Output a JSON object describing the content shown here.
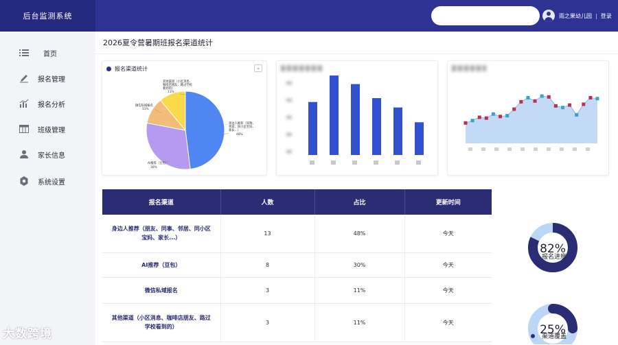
{
  "app": {
    "title": "后台监测系统"
  },
  "header": {
    "search_placeholder": "",
    "user_name": "雨之果幼儿园",
    "separator": "|",
    "login_label": "登录"
  },
  "sidebar": {
    "items": [
      {
        "label": "首页",
        "icon": "list-icon"
      },
      {
        "label": "报名管理",
        "icon": "pencil-icon"
      },
      {
        "label": "报名分析",
        "icon": "bar-chart-icon"
      },
      {
        "label": "班级管理",
        "icon": "grid-icon"
      },
      {
        "label": "家长信息",
        "icon": "person-icon"
      },
      {
        "label": "系统设置",
        "icon": "gear-icon"
      }
    ]
  },
  "main": {
    "page_title": "2026夏令营暑期班报名渠道统计",
    "pie_card": {
      "title": "报名渠道统计",
      "labels": [
        {
          "line1": "身边人推荐（同款、",
          "line2": "邻居、同小区宝妈、",
          "line3": "家长...）",
          "pct": "48%"
        },
        {
          "line1": "AI推荐（豆包）",
          "pct": "30%"
        },
        {
          "line1": "微信私域报名",
          "pct": "11%"
        },
        {
          "line1": "其他渠道（小区消息、",
          "line2": "咖啡店朋友、路过学校",
          "line3": "看到的）",
          "pct": "11%"
        }
      ]
    },
    "table": {
      "headers": [
        "报名渠道",
        "人数",
        "占比",
        "更新时间"
      ],
      "rows": [
        {
          "channel_line1": "身边人推荐（朋友、同事、邻居、同小区",
          "channel_line2": "宝妈、家长...）",
          "count": "13",
          "pct": "48%",
          "time": "今天"
        },
        {
          "channel_line1": "AI推荐（豆包）",
          "channel_line2": "",
          "count": "8",
          "pct": "30%",
          "time": "今天"
        },
        {
          "channel_line1": "微信私域报名",
          "channel_line2": "",
          "count": "3",
          "pct": "11%",
          "time": "今天"
        },
        {
          "channel_line1": "其他渠道（小区消息、咖啡店朋友、路过",
          "channel_line2": "学校看到的）",
          "count": "3",
          "pct": "11%",
          "time": "今天"
        }
      ]
    },
    "rings": [
      {
        "value_text": "82%",
        "label": "报名进度"
      },
      {
        "value_text": "25%",
        "label": "渠道覆盖"
      }
    ]
  },
  "watermark": "大数跨境",
  "colors": {
    "header": "#2e3292",
    "brand_bg": "#262a7e",
    "table_head": "#2a2c74",
    "bar": "#3251cf",
    "ring_dark": "#2a2c74",
    "ring_light": "#bcd7f6"
  },
  "chart_data": [
    {
      "type": "pie",
      "title": "报名渠道统计",
      "categories": [
        "身边人推荐（同款、邻居、同小区宝妈、家长...）",
        "AI推荐（豆包）",
        "微信私域报名",
        "其他渠道（小区消息、咖啡店朋友、路过学校看到的）"
      ],
      "values": [
        48,
        30,
        11,
        11
      ],
      "colors": [
        "#4f86f2",
        "#b59af0",
        "#f2bd78",
        "#fbd948"
      ]
    },
    {
      "type": "bar",
      "title": "",
      "categories": [
        "1",
        "2",
        "3",
        "4",
        "5",
        "6"
      ],
      "values": [
        6.8,
        10.2,
        9.1,
        7.3,
        6.1,
        4.2
      ],
      "ylim": [
        0,
        11
      ]
    },
    {
      "type": "line",
      "title": "",
      "x": [
        1,
        2,
        3,
        4,
        5,
        6,
        7,
        8,
        9,
        10,
        11,
        12,
        13,
        14,
        15,
        16,
        17,
        18,
        19,
        20
      ],
      "series": [
        {
          "values": [
            2.5,
            2.8,
            3.2,
            3.1,
            3.6,
            3.3,
            3.4,
            4.2,
            5.1,
            5.6,
            5.2,
            5.8,
            5.7,
            4.6,
            4.4,
            4.7,
            3.5,
            4.8,
            5.6,
            5.5
          ]
        }
      ],
      "ylim": [
        0,
        8
      ]
    },
    {
      "type": "pie",
      "title": "",
      "categories": [
        "报名进度"
      ],
      "values": [
        82
      ]
    },
    {
      "type": "pie",
      "title": "",
      "categories": [
        "渠道覆盖"
      ],
      "values": [
        25
      ]
    }
  ]
}
